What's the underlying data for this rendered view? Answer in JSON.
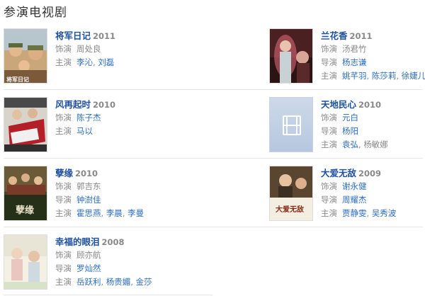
{
  "section": {
    "title": "参演电视剧"
  },
  "labels": {
    "role": "饰演",
    "director": "导演",
    "starring": "主演"
  },
  "shows": [
    {
      "title": "将军日记",
      "year": "2011",
      "role": "周处良",
      "starring": [
        "李沁",
        "刘磊"
      ]
    },
    {
      "title": "兰花香",
      "year": "2011",
      "role": "汤君竹",
      "director": "杨志谦",
      "starring": [
        "姚芊羽",
        "陈莎莉",
        "徐婕儿"
      ]
    },
    {
      "title": "风再起时",
      "year": "2010",
      "role": "陈子杰",
      "starring": [
        "马以"
      ]
    },
    {
      "title": "天地民心",
      "year": "2010",
      "role": "元白",
      "director": "杨阳",
      "starring": [
        "袁弘",
        "杨敏娜"
      ]
    },
    {
      "title": "孽缘",
      "year": "2010",
      "role": "郭吉东",
      "director": "钟澍佳",
      "starring": [
        "霍思燕",
        "李晨",
        "李曼"
      ]
    },
    {
      "title": "大爱无敌",
      "year": "2009",
      "role": "谢永健",
      "director": "周耀杰",
      "starring": [
        "贾静雯",
        "吴秀波"
      ]
    },
    {
      "title": "幸福的眼泪",
      "year": "2008",
      "role": "顾亦航",
      "director": "罗灿然",
      "starring": [
        "岳跃利",
        "杨贵媚",
        "金莎"
      ]
    }
  ],
  "posters": {
    "show1": {
      "poster_text": "将军日记"
    },
    "show5": {
      "poster_text": "孽缘"
    },
    "show6": {
      "poster_text": "大爱无敌"
    }
  },
  "colors": {
    "title_link": "#1e50a2",
    "name_link": "#2b6dc2",
    "meta": "#888888",
    "divider": "#e6e6e6"
  }
}
